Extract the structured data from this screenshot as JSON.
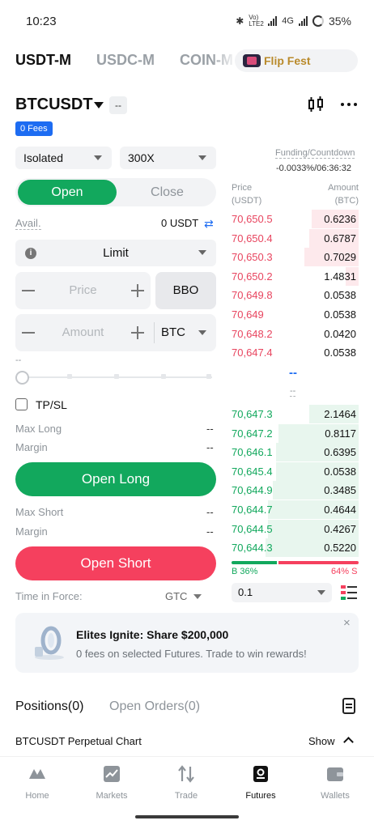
{
  "status_bar": {
    "time": "10:23",
    "network_small": "Vo) LTE2",
    "network": "4G",
    "battery": "35%"
  },
  "market_tabs": [
    "USDT-M",
    "USDC-M",
    "COIN-M"
  ],
  "promo_pill": {
    "label": "Flip Fest",
    "icon": "flip-fest-icon"
  },
  "pair": {
    "symbol": "BTCUSDT",
    "change": "--",
    "fees_badge": "0 Fees"
  },
  "order_form": {
    "margin_mode": "Isolated",
    "leverage": "300X",
    "open_label": "Open",
    "close_label": "Close",
    "avail_label": "Avail.",
    "avail_value": "0 USDT",
    "order_type": "Limit",
    "price_placeholder": "Price",
    "bbo_label": "BBO",
    "amount_placeholder": "Amount",
    "amount_unit": "BTC",
    "slider_caption": "--",
    "tpsl_label": "TP/SL",
    "max_long_label": "Max Long",
    "max_long_value": "--",
    "margin_label": "Margin",
    "margin_long_value": "--",
    "open_long_label": "Open Long",
    "max_short_label": "Max Short",
    "max_short_value": "--",
    "margin_short_value": "--",
    "open_short_label": "Open Short",
    "time_in_force_label": "Time in Force:",
    "time_in_force_value": "GTC"
  },
  "order_book": {
    "funding_label": "Funding/Countdown",
    "funding_value": "-0.0033%/06:36:32",
    "price_header": "Price",
    "price_unit": "(USDT)",
    "amount_header": "Amount",
    "amount_unit": "(BTC)",
    "asks": [
      {
        "price": "70,650.5",
        "amount": "0.6236",
        "depth": 0.36
      },
      {
        "price": "70,650.4",
        "amount": "0.6787",
        "depth": 0.38
      },
      {
        "price": "70,650.3",
        "amount": "0.7029",
        "depth": 0.42
      },
      {
        "price": "70,650.2",
        "amount": "1.4831",
        "depth": 0.1
      },
      {
        "price": "70,649.8",
        "amount": "0.0538",
        "depth": 0
      },
      {
        "price": "70,649",
        "amount": "0.0538",
        "depth": 0
      },
      {
        "price": "70,648.2",
        "amount": "0.0420",
        "depth": 0
      },
      {
        "price": "70,647.4",
        "amount": "0.0538",
        "depth": 0
      }
    ],
    "mid_price": "--",
    "mark_price": "--",
    "bids": [
      {
        "price": "70,647.3",
        "amount": "2.1464",
        "depth": 0.38
      },
      {
        "price": "70,647.2",
        "amount": "0.8117",
        "depth": 0.62
      },
      {
        "price": "70,646.1",
        "amount": "0.6395",
        "depth": 0.64
      },
      {
        "price": "70,645.4",
        "amount": "0.0538",
        "depth": 0.64
      },
      {
        "price": "70,644.9",
        "amount": "0.3485",
        "depth": 0.66
      },
      {
        "price": "70,644.7",
        "amount": "0.4644",
        "depth": 0.7
      },
      {
        "price": "70,644.5",
        "amount": "0.4267",
        "depth": 0.7
      },
      {
        "price": "70,644.3",
        "amount": "0.5220",
        "depth": 0.72
      }
    ],
    "buy_ratio": 36,
    "buy_label": "B 36%",
    "sell_label": "64% S",
    "depth_step": "0.1"
  },
  "banner": {
    "title": "Elites Ignite: Share $200,000",
    "subtitle": "0 fees on selected Futures. Trade to win rewards!",
    "close_glyph": "×"
  },
  "positions": {
    "tab_positions": "Positions(0)",
    "tab_orders": "Open Orders(0)",
    "chart_label": "BTCUSDT Perpetual Chart",
    "show_label": "Show"
  },
  "bottom_nav": [
    {
      "label": "Home",
      "icon": "home-icon"
    },
    {
      "label": "Markets",
      "icon": "markets-icon"
    },
    {
      "label": "Trade",
      "icon": "trade-icon"
    },
    {
      "label": "Futures",
      "icon": "futures-icon",
      "active": true
    },
    {
      "label": "Wallets",
      "icon": "wallet-icon"
    }
  ],
  "colors": {
    "buy": "#12a85d",
    "sell": "#f5405e",
    "accent": "#1d6cf2",
    "promo_gold": "#b98a2b"
  }
}
